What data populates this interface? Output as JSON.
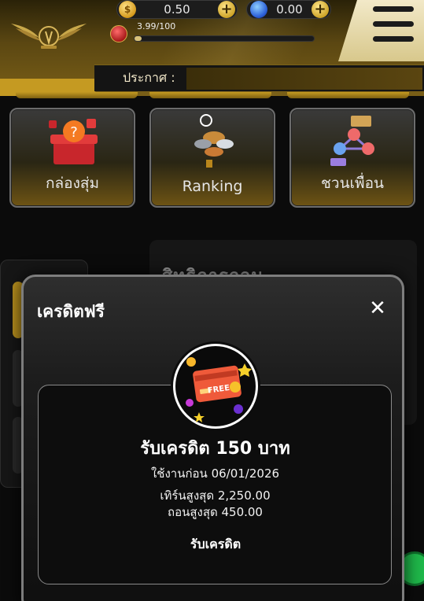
{
  "header": {
    "coin_balance": "0.50",
    "gem_balance": "0.00",
    "coin_symbol": "$",
    "xp_text": "3.99/100",
    "xp_progress": 0.04,
    "announcement_label": "ประกาศ :"
  },
  "feature_cards": [
    {
      "label": "กล่องสุ่ม"
    },
    {
      "label": "Ranking"
    },
    {
      "label": "ชวนเพื่อน"
    }
  ],
  "background": {
    "section_heading": "สิทธิการถอน"
  },
  "modal": {
    "title": "เครดิตฟรี",
    "close_symbol": "✕",
    "badge_text": "FREE",
    "offer_title": "รับเครดิต 150 บาท",
    "expiry": "ใช้งานก่อน 06/01/2026",
    "max_turnover": "เทิร์นสูงสุด 2,250.00",
    "max_withdraw": "ถอนสูงสุด 450.00",
    "claim_label": "รับเครดิต"
  },
  "colors": {
    "gold": "#c59a22",
    "modal_border": "#7d7d7d",
    "fab_green": "#1fb84a"
  }
}
